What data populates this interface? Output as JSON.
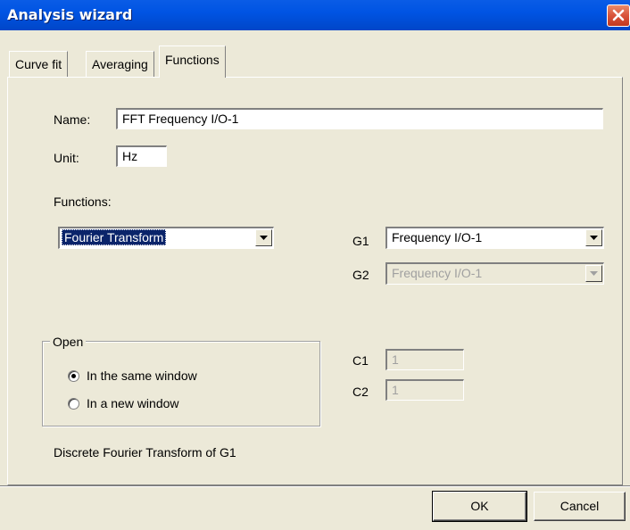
{
  "window": {
    "title": "Analysis wizard"
  },
  "tabs": [
    {
      "label": "Curve fit",
      "active": false
    },
    {
      "label": "Averaging",
      "active": false
    },
    {
      "label": "Functions",
      "active": true
    }
  ],
  "form": {
    "name_label": "Name:",
    "name_value": "FFT Frequency I/O-1",
    "unit_label": "Unit:",
    "unit_value": "Hz",
    "functions_label": "Functions:",
    "function_selected": "Fourier Transform",
    "g1_label": "G1",
    "g1_value": "Frequency I/O-1",
    "g2_label": "G2",
    "g2_value": "Frequency I/O-1",
    "c1_label": "C1",
    "c1_value": "1",
    "c2_label": "C2",
    "c2_value": "1"
  },
  "open_group": {
    "title": "Open",
    "options": [
      {
        "label": "In the same window",
        "checked": true
      },
      {
        "label": "In a new window",
        "checked": false
      }
    ]
  },
  "description": "Discrete Fourier Transform of G1",
  "buttons": {
    "ok": "OK",
    "cancel": "Cancel"
  },
  "colors": {
    "titlebar": "#0054e3",
    "dialog_bg": "#ece9d8",
    "selection": "#0a246a",
    "close_button": "#d9543b"
  },
  "icons": {
    "close": "close-icon",
    "dropdown": "chevron-down-icon"
  }
}
